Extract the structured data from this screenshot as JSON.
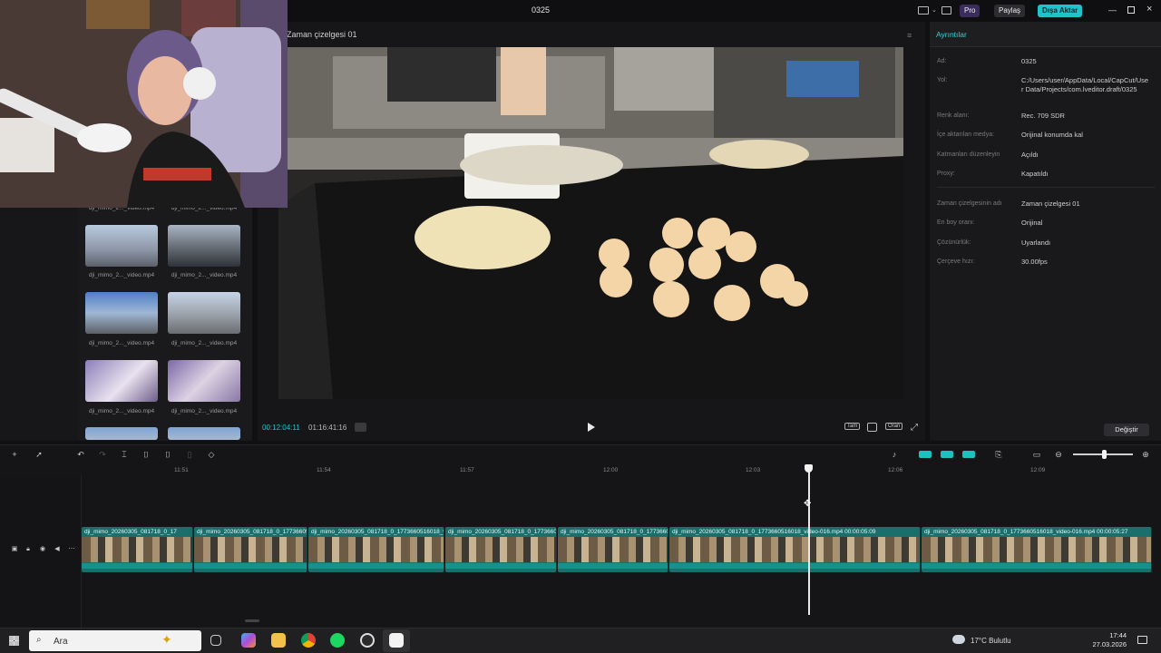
{
  "window": {
    "title": "0325"
  },
  "titlebar": {
    "pro_label": "Pro",
    "share_label": "Paylaş",
    "export_label": "Dışa Aktar"
  },
  "player": {
    "title": "Zaman çizelgesi 01",
    "current_time": "00:12:04:11",
    "duration": "01:16:41:16",
    "controls": {
      "ratio": "Tam",
      "crop": "Oran"
    }
  },
  "media": {
    "items": [
      {
        "label": "dji_mimo_2..._video.mp4"
      },
      {
        "label": "dji_mimo_2..._video.mp4"
      },
      {
        "label": "dji_mimo_2..._video.mp4"
      },
      {
        "label": "dji_mimo_2..._video.mp4"
      },
      {
        "label": "dji_mimo_2..._video.mp4"
      },
      {
        "label": "dji_mimo_2..._video.mp4"
      },
      {
        "label": "dji_mimo_2..._video.mp4"
      },
      {
        "label": "dji_mimo_2..._video.mp4"
      }
    ]
  },
  "details": {
    "title": "Ayrıntılar",
    "rows": [
      {
        "label": "Ad:",
        "value": "0325"
      },
      {
        "label": "Yol:",
        "value": "C:/Users/user/AppData/Local/CapCut/User Data/Projects/com.lveditor.draft/0325"
      },
      {
        "label": "Renk alanı:",
        "value": "Rec. 709 SDR"
      },
      {
        "label": "İçe aktarılan medya:",
        "value": "Orijinal konumda kal"
      },
      {
        "label": "Katmanları düzenleyin",
        "value": "Açıldı"
      },
      {
        "label": "Proxy:",
        "value": "Kapatıldı"
      },
      {
        "label": "Zaman çizelgesinin adı",
        "value": "Zaman çizelgesi 01"
      },
      {
        "label": "En boy oranı:",
        "value": "Orijinal"
      },
      {
        "label": "Çözünürlük:",
        "value": "Uyarlandı"
      },
      {
        "label": "Çerçeve hızı:",
        "value": "30.00fps"
      }
    ],
    "change_label": "Değiştir"
  },
  "timeline": {
    "ticks": [
      "11:51",
      "11:54",
      "11:57",
      "12:00",
      "12:03",
      "12:06",
      "12:09"
    ],
    "clips": [
      {
        "name": "dji_mimo_20260305_081718_0_17"
      },
      {
        "name": "dji_mimo_20260305_081718_0_17736605"
      },
      {
        "name": "dji_mimo_20260305_081718_0_1773660516018_vi"
      },
      {
        "name": "dji_mimo_20260305_081718_0_17736605"
      },
      {
        "name": "dji_mimo_20260305_081718_0_1773660"
      },
      {
        "name": "dji_mimo_20260305_081718_0_1773660516018_video-016.mp4   00:00:05:09"
      },
      {
        "name": "dji_mimo_20260305_081718_0_1773660516018_video-016.mp4   00:00:05:27"
      }
    ]
  },
  "taskbar": {
    "search_placeholder": "Ara",
    "weather": "17°C Bulutlu",
    "time": "17:44",
    "date": "27.03.2026"
  },
  "colors": {
    "accent": "#20c5c5",
    "export": "#1fc3c9",
    "clip": "#1a6e6c"
  }
}
